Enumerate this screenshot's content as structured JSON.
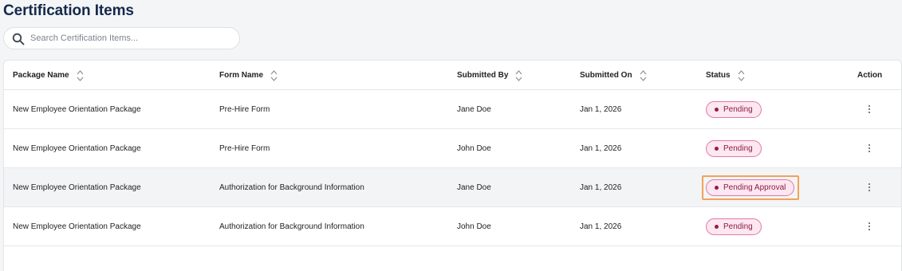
{
  "page": {
    "title": "Certification Items"
  },
  "search": {
    "placeholder": "Search Certification Items..."
  },
  "table": {
    "columns": [
      "Package Name",
      "Form Name",
      "Submitted By",
      "Submitted On",
      "Status",
      "Action"
    ],
    "rows": [
      {
        "package": "New Employee Orientation Package",
        "form": "Pre-Hire Form",
        "submitted_by": "Jane Doe",
        "submitted_on": "Jan 1, 2026",
        "status": "Pending"
      },
      {
        "package": "New Employee Orientation Package",
        "form": "Pre-Hire Form",
        "submitted_by": "John Doe",
        "submitted_on": "Jan 1, 2026",
        "status": "Pending"
      },
      {
        "package": "New Employee Orientation Package",
        "form": "Authorization for Background Information",
        "submitted_by": "Jane Doe",
        "submitted_on": "Jan 1, 2026",
        "status": "Pending Approval"
      },
      {
        "package": "New Employee Orientation Package",
        "form": "Authorization for Background Information",
        "submitted_by": "John Doe",
        "submitted_on": "Jan 1, 2026",
        "status": "Pending"
      }
    ]
  },
  "colors": {
    "title": "#14294a",
    "badge_border": "#e07aa8",
    "badge_bg": "#fde7f0",
    "badge_text": "#8b1c45",
    "highlight": "#f0a35a"
  },
  "icons": {
    "search": "search-icon",
    "sort": "sort-icon",
    "action": "kebab-menu-icon"
  }
}
